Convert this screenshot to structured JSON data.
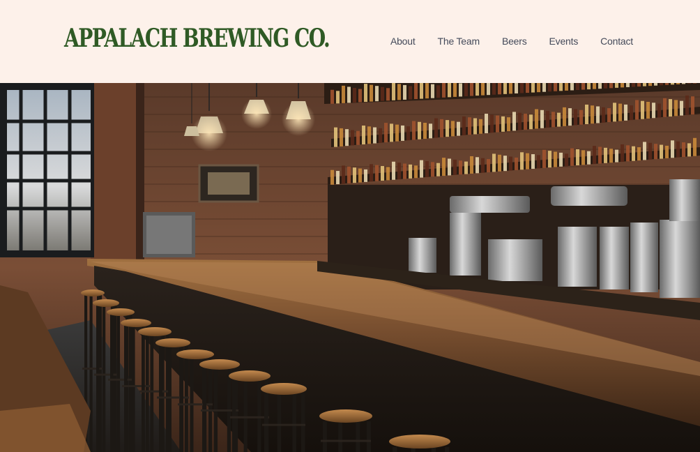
{
  "header": {
    "logo_text": "APPALACH BREWING CO.",
    "nav": {
      "about": "About",
      "team": "The Team",
      "beers": "Beers",
      "events": "Events",
      "contact": "Contact"
    }
  },
  "colors": {
    "background": "#fdf1ea",
    "logo": "#2f5a25",
    "nav_text": "#444a5a"
  }
}
